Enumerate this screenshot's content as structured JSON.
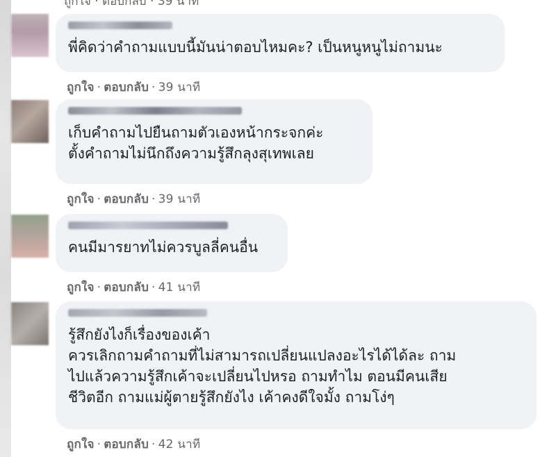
{
  "comments": [
    {
      "text": "พี่คิดว่าคำถามแบบนี้มันน่าตอบไหมคะ? เป็นหนูหนูไม่ถามนะ",
      "like": "ถูกใจ",
      "sep": "·",
      "reply": "ตอบกลับ",
      "time": "39 นาที"
    },
    {
      "text": "เก็บคำถามไปยืนถามตัวเองหน้ากระจกค่ะ\nตั้งคำถามไม่นึกถึงความรู้สึกลุงสุเทพเลย",
      "like": "ถูกใจ",
      "sep": "·",
      "reply": "ตอบกลับ",
      "time": "39 นาที"
    },
    {
      "text": "คนมีมารยาทไม่ควรบูลลี่คนอื่น",
      "like": "ถูกใจ",
      "sep": "·",
      "reply": "ตอบกลับ",
      "time": "41 นาที"
    },
    {
      "text": "รู้สึกยังไงก็เรื่องของเค้า\nควรเลิกถามคำถามที่ไม่สามารถเปลี่ยนแปลงอะไรได้ได้ละ ถาม\nไปแล้วความรู้สึกเค้าจะเปลี่ยนไปหรอ ถามทำไม ตอนมีคนเสีย\nชีวิตอีก ถามแม่ผู้ตายรู้สึกยังไง เค้าคงดีใจมั้ง ถามโง่ๆ",
      "like": "ถูกใจ",
      "sep": "·",
      "reply": "ตอบกลับ",
      "time": "42 นาที"
    }
  ],
  "colors": {
    "bubble": "#f0f2f5",
    "meta": "#65676b",
    "text": "#1c1e21"
  }
}
